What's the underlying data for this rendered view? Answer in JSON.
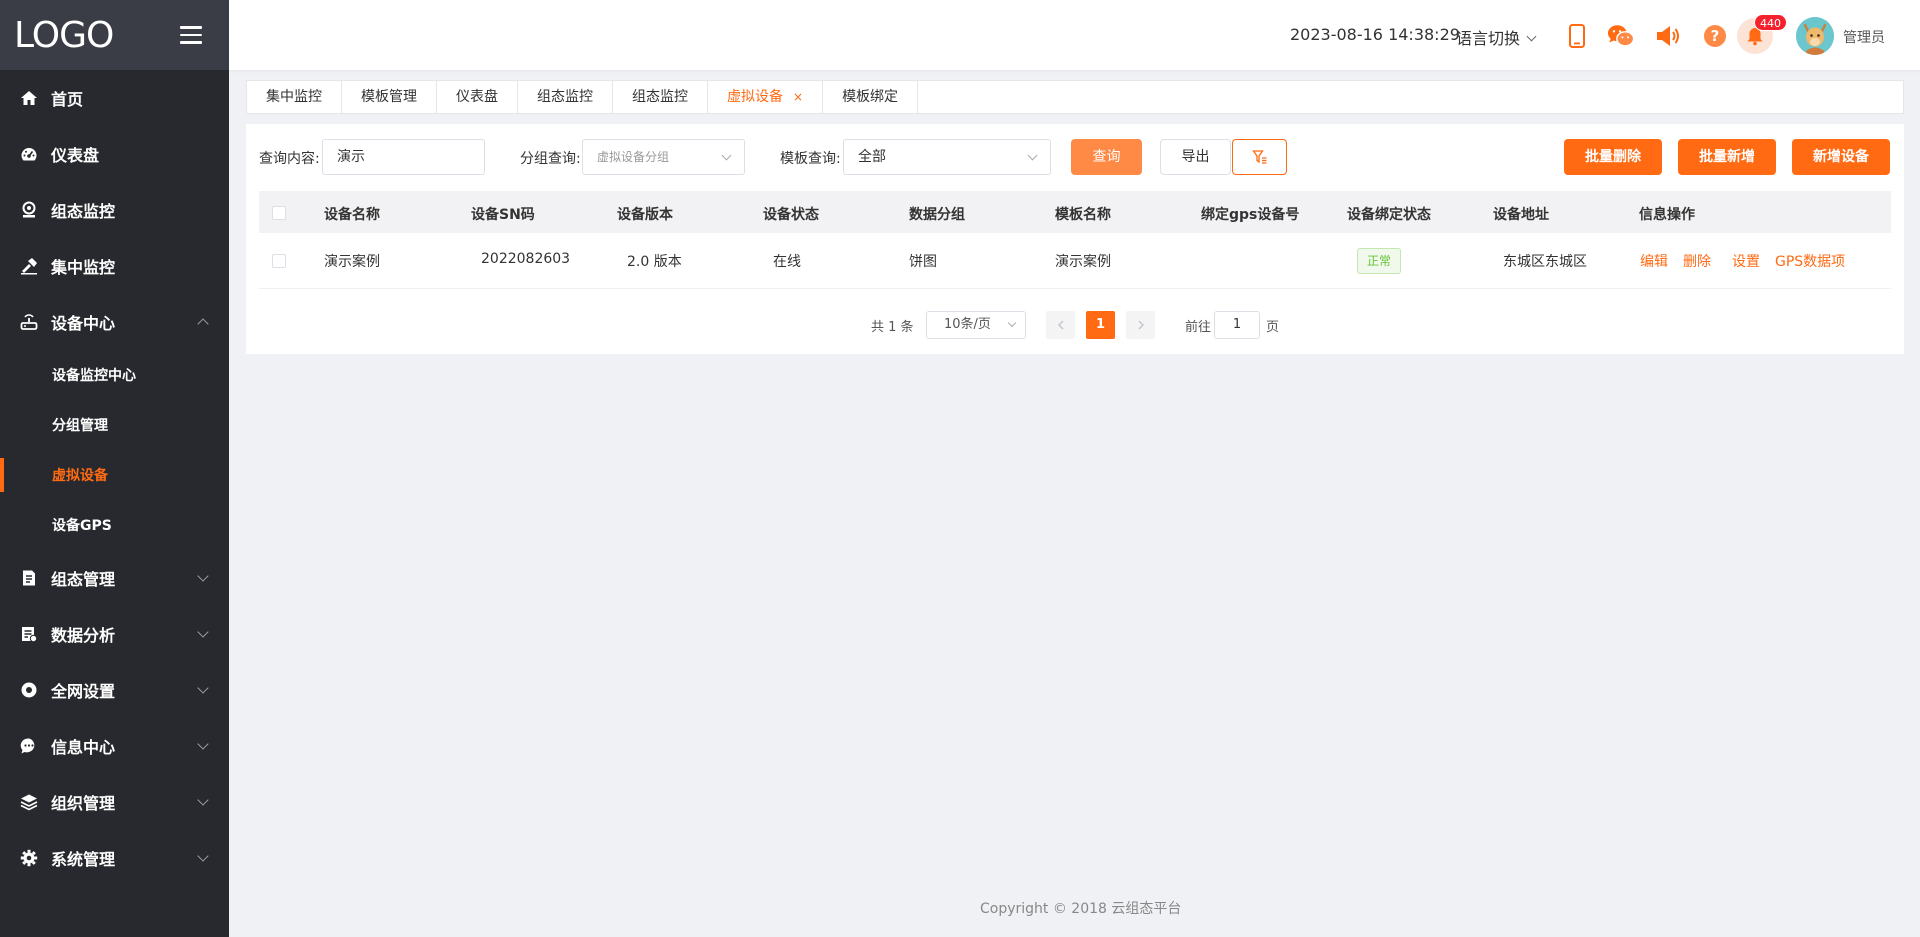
{
  "sidebar": {
    "logo": "LOGO",
    "menu": [
      {
        "label": "首页",
        "icon": "home-icon"
      },
      {
        "label": "仪表盘",
        "icon": "dashboard-icon"
      },
      {
        "label": "组态监控",
        "icon": "monitor-icon"
      },
      {
        "label": "集中监控",
        "icon": "hammer-icon"
      },
      {
        "label": "设备中心",
        "icon": "router-icon"
      },
      {
        "label": "组态管理",
        "icon": "document-icon"
      },
      {
        "label": "数据分析",
        "icon": "report-icon"
      },
      {
        "label": "全网设置",
        "icon": "circle-icon"
      },
      {
        "label": "信息中心",
        "icon": "chat-icon"
      },
      {
        "label": "组织管理",
        "icon": "layers-icon"
      },
      {
        "label": "系统管理",
        "icon": "gear-icon"
      }
    ],
    "submenu": [
      {
        "label": "设备监控中心"
      },
      {
        "label": "分组管理"
      },
      {
        "label": "虚拟设备"
      },
      {
        "label": "设备GPS"
      }
    ]
  },
  "header": {
    "datetime": "2023-08-16 14:38:29",
    "language": "语言切换",
    "badge_count": "440",
    "username": "管理员"
  },
  "tabs": [
    {
      "label": "集中监控"
    },
    {
      "label": "模板管理"
    },
    {
      "label": "仪表盘"
    },
    {
      "label": "组态监控"
    },
    {
      "label": "组态监控"
    },
    {
      "label": "虚拟设备",
      "close": "×"
    },
    {
      "label": "模板绑定"
    }
  ],
  "filter": {
    "query_label": "查询内容:",
    "query_value": "演示",
    "group_label": "分组查询:",
    "group_placeholder": "虚拟设备分组",
    "template_label": "模板查询:",
    "template_value": "全部",
    "query_button": "查询",
    "export_button": "导出",
    "batch_delete": "批量删除",
    "batch_add": "批量新增",
    "add_device": "新增设备"
  },
  "table": {
    "headers": [
      "设备名称",
      "设备SN码",
      "设备版本",
      "设备状态",
      "数据分组",
      "模板名称",
      "绑定gps设备号",
      "设备绑定状态",
      "设备地址",
      "信息操作"
    ],
    "rows": [
      {
        "name": "演示案例",
        "sn": "2022082603",
        "version": "2.0 版本",
        "status": "在线",
        "group": "饼图",
        "template": "演示案例",
        "gps": "",
        "bind_status": "正常",
        "address": "东城区东城区",
        "ops": [
          "编辑",
          "删除",
          "设置",
          "GPS数据项"
        ]
      }
    ]
  },
  "pagination": {
    "total": "共 1 条",
    "page_size": "10条/页",
    "current": "1",
    "goto_label": "前往",
    "goto_value": "1",
    "page_suffix": "页"
  },
  "footer": "Copyright © 2018 云组态平台",
  "colors": {
    "accent": "#ff6a13",
    "sidebar": "#27292e",
    "logo_bar": "#3a3d45"
  }
}
